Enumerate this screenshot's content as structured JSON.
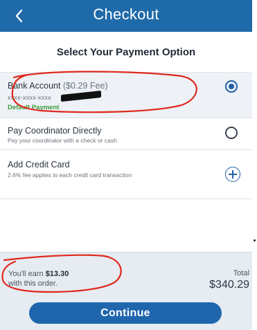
{
  "header": {
    "title": "Checkout",
    "back_icon": "chevron-left-icon"
  },
  "subheader": {
    "title": "Select Your Payment Option"
  },
  "options": [
    {
      "label": "Bank Account",
      "fee": "($0.29 Fee)",
      "account_mask": "xxxx-xxxx-xxxx",
      "default_label": "Default Payment",
      "selected": true
    },
    {
      "label": "Pay Coordinator Directly",
      "description": "Pay your coordinator with a check or cash",
      "selected": false
    },
    {
      "label": "Add Credit Card",
      "description": "2.6% fee applies to each credit card transaction",
      "icon": "plus-circle-icon"
    }
  ],
  "footer": {
    "earn_prefix": "You'll earn",
    "earn_amount": "$13.30",
    "earn_suffix": "with this order.",
    "total_label": "Total",
    "total_value": "$340.29",
    "continue_label": "Continue"
  },
  "colors": {
    "header_bg": "#1f6aa9",
    "button_bg": "#1f66ad",
    "default_green": "#3a9a3a",
    "annotation_red": "#e0281e"
  }
}
